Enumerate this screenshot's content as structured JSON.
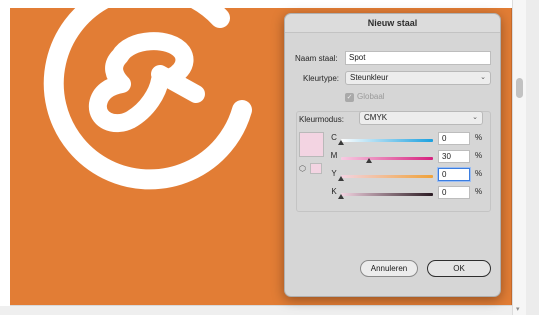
{
  "dialog": {
    "title": "Nieuw staal",
    "name_label": "Naam staal:",
    "name_value": "Spot",
    "color_type_label": "Kleurtype:",
    "color_type_value": "Steunkleur",
    "global_label": "Globaal",
    "global_checked": true,
    "color_mode_label": "Kleurmodus:",
    "color_mode_value": "CMYK",
    "swatch_color": "#f3d4e2",
    "channels": [
      {
        "label": "C",
        "value": "0",
        "unit": "%",
        "level": 0
      },
      {
        "label": "M",
        "value": "30",
        "unit": "%",
        "level": 0.3
      },
      {
        "label": "Y",
        "value": "0",
        "unit": "%",
        "level": 0
      },
      {
        "label": "K",
        "value": "0",
        "unit": "%",
        "level": 0
      }
    ],
    "cancel_label": "Annuleren",
    "ok_label": "OK"
  },
  "artboard": {
    "fill_color": "#e27d35",
    "logo_color": "#ffffff"
  },
  "icons": {
    "chevron": "chevron-down-icon",
    "checkmark": "checkmark-icon",
    "out_of_gamut": "cube-icon"
  }
}
